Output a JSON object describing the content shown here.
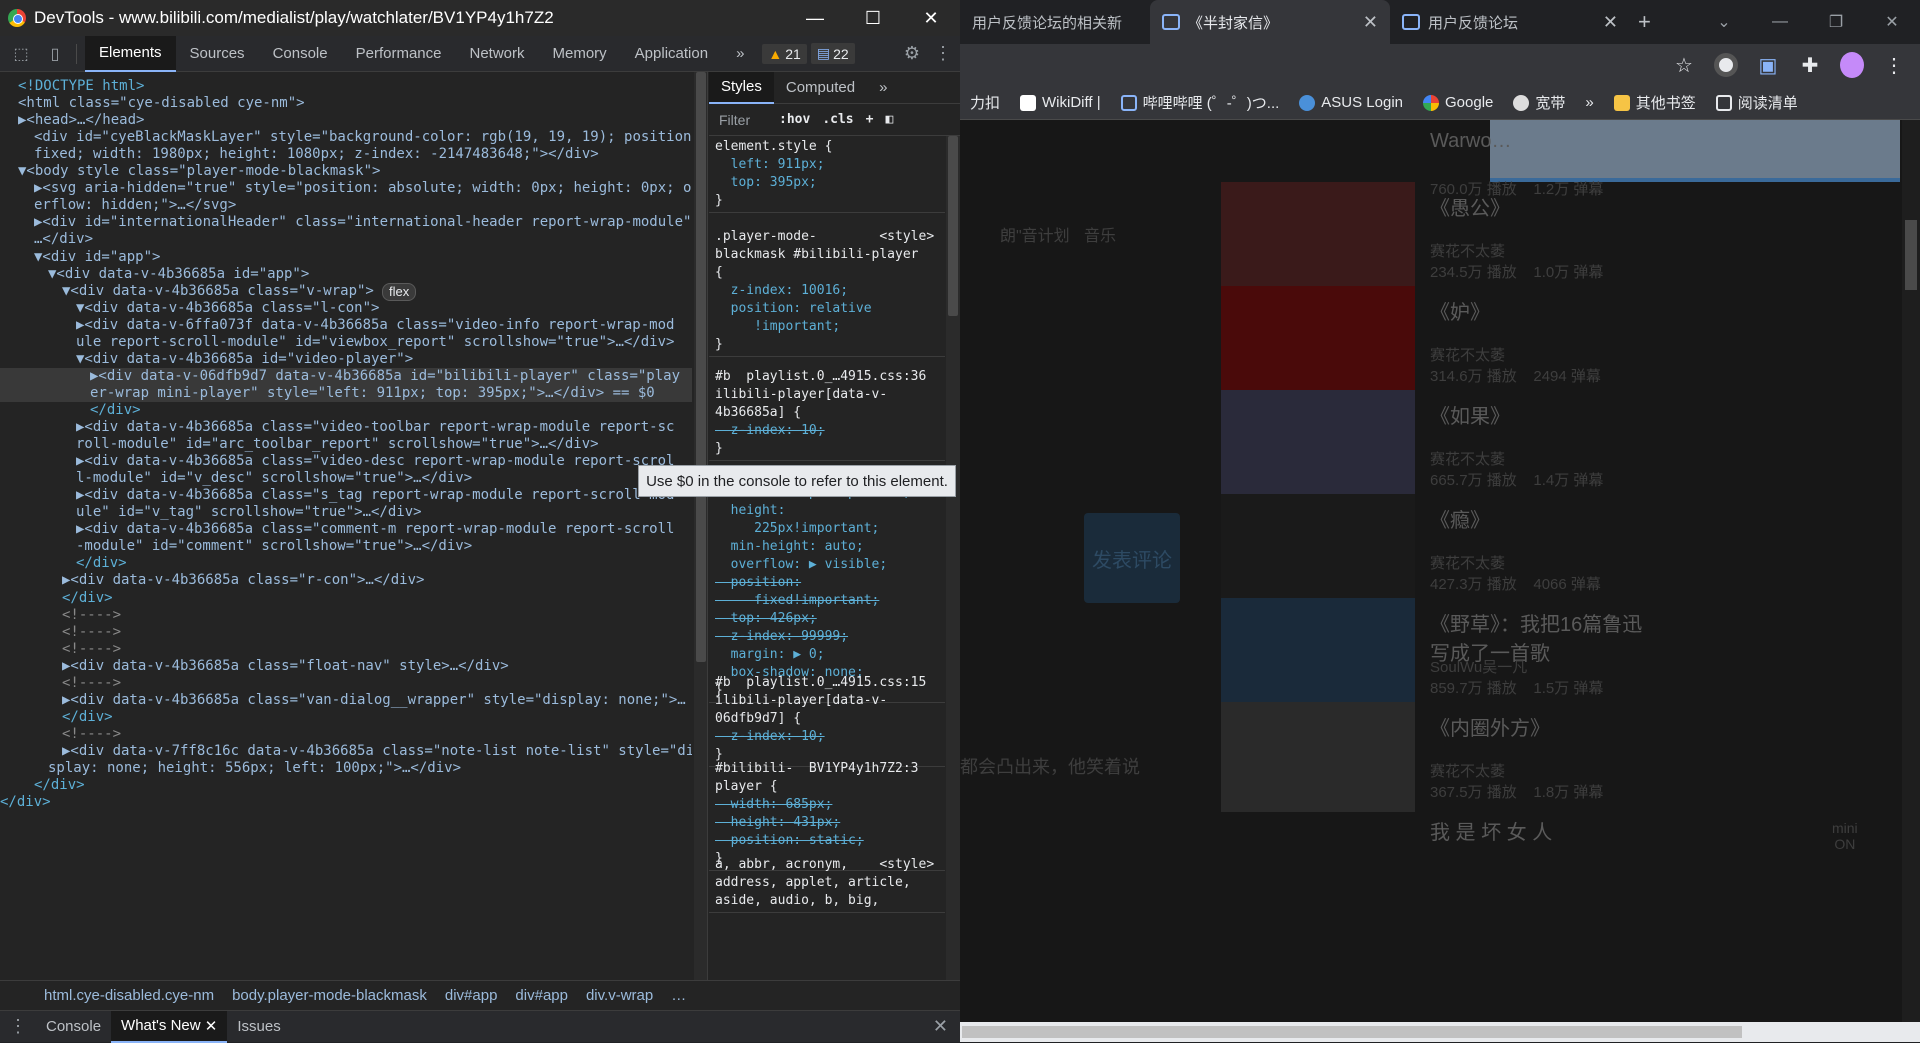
{
  "devtools": {
    "title": "DevTools - www.bilibili.com/medialist/play/watchlater/BV1YP4y1h7Z2",
    "window_buttons": [
      "—",
      "☐",
      "✕"
    ],
    "tabs": [
      "Elements",
      "Sources",
      "Console",
      "Performance",
      "Network",
      "Memory",
      "Application"
    ],
    "more_tabs": "»",
    "warnings": "21",
    "messages": "22",
    "dom_lines": [
      {
        "k": "doctype",
        "t": "<!DOCTYPE html>"
      },
      {
        "k": "t1",
        "t": "<html class=\"cye-disabled cye-nm\">"
      },
      {
        "k": "t2",
        "t": "▶<head>…</head>"
      },
      {
        "k": "t3",
        "t": "<div id=\"cyeBlackMaskLayer\" style=\"background-color: rgb(19, 19, 19); position:"
      },
      {
        "k": "t4",
        "t": "fixed; width: 1980px; height: 1080px; z-index: -2147483648;\"></div>"
      },
      {
        "k": "t5",
        "t": "▼<body style class=\"player-mode-blackmask\">"
      },
      {
        "k": "t6",
        "t": "▶<svg aria-hidden=\"true\" style=\"position: absolute; width: 0px; height: 0px; ov"
      },
      {
        "k": "t7",
        "t": "erflow: hidden;\">…</svg>"
      },
      {
        "k": "t8",
        "t": "▶<div id=\"internationalHeader\" class=\"international-header report-wrap-module\">"
      },
      {
        "k": "t9",
        "t": "…</div>"
      },
      {
        "k": "t10",
        "t": "▼<div id=\"app\">"
      },
      {
        "k": "t11",
        "t": "▼<div data-v-4b36685a id=\"app\">"
      },
      {
        "k": "t12",
        "t": "▼<div data-v-4b36685a class=\"v-wrap\">"
      },
      {
        "k": "t13",
        "t": "▼<div data-v-4b36685a class=\"l-con\">"
      },
      {
        "k": "t14",
        "t": "▶<div data-v-6ffa073f data-v-4b36685a class=\"video-info report-wrap-mod"
      },
      {
        "k": "t15",
        "t": "ule report-scroll-module\" id=\"viewbox_report\" scrollshow=\"true\">…</div>"
      },
      {
        "k": "t16",
        "t": "▼<div data-v-4b36685a id=\"video-player\">"
      },
      {
        "k": "t17",
        "t": "▶<div data-v-06dfb9d7 data-v-4b36685a id=\"bilibili-player\" class=\"play"
      },
      {
        "k": "t18",
        "t": "er-wrap mini-player\" style=\"left: 911px; top: 395px;\">…</div> == $0"
      },
      {
        "k": "t19",
        "t": "</div>"
      },
      {
        "k": "t20",
        "t": "▶<div data-v-4b36685a class=\"video-toolbar report-wrap-module report-sc"
      },
      {
        "k": "t21",
        "t": "roll-module\" id=\"arc_toolbar_report\" scrollshow=\"true\">…</div>"
      },
      {
        "k": "t22",
        "t": "▶<div data-v-4b36685a class=\"video-desc report-wrap-module report-scrol"
      },
      {
        "k": "t23",
        "t": "l-module\" id=\"v_desc\" scrollshow=\"true\">…</div>"
      },
      {
        "k": "t24",
        "t": "▶<div data-v-4b36685a class=\"s_tag report-wrap-module report-scroll-mod"
      },
      {
        "k": "t25",
        "t": "ule\" id=\"v_tag\" scrollshow=\"true\">…</div>"
      },
      {
        "k": "t26",
        "t": "▶<div data-v-4b36685a class=\"comment-m report-wrap-module report-scroll"
      },
      {
        "k": "t27",
        "t": "-module\" id=\"comment\" scrollshow=\"true\">…</div>"
      },
      {
        "k": "t28",
        "t": "</div>"
      },
      {
        "k": "t29",
        "t": "▶<div data-v-4b36685a class=\"r-con\">…</div>"
      },
      {
        "k": "t30",
        "t": "</div>"
      },
      {
        "k": "t31",
        "t": "<!---->"
      },
      {
        "k": "t32",
        "t": "<!---->"
      },
      {
        "k": "t33",
        "t": "<!---->"
      },
      {
        "k": "t34",
        "t": "▶<div data-v-4b36685a class=\"float-nav\" style>…</div>"
      },
      {
        "k": "t35",
        "t": "<!---->"
      },
      {
        "k": "t36",
        "t": "▶<div data-v-4b36685a class=\"van-dialog__wrapper\" style=\"display: none;\">…"
      },
      {
        "k": "t37",
        "t": "</div>"
      },
      {
        "k": "t38",
        "t": "<!---->"
      },
      {
        "k": "t39",
        "t": "▶<div data-v-7ff8c16c data-v-4b36685a class=\"note-list note-list\" style=\"di"
      },
      {
        "k": "t40",
        "t": "splay: none; height: 556px; left: 100px;\">…</div>"
      },
      {
        "k": "t41",
        "t": "</div>"
      },
      {
        "k": "t42",
        "t": "</div>"
      }
    ],
    "flex_badge": "flex",
    "tooltip": "Use $0 in the console to refer to this element.",
    "styles": {
      "tabs": [
        "Styles",
        "Computed",
        "»"
      ],
      "filter_placeholder": "Filter",
      "hov": ":hov",
      "cls": ".cls",
      "rules": [
        {
          "lines": [
            "element.style {",
            "  left: 911px;",
            "  top: 395px;",
            "}"
          ]
        },
        {
          "lines": [
            ".player-mode-        <style>",
            "blackmask #bilibili-player",
            "{",
            "  z-index: 10016;",
            "  position: relative",
            "     !important;",
            "}"
          ]
        },
        {
          "lines": [
            "#b  playlist.0_…4915.css:36",
            "ilibili-player[data-v-",
            "4b36685a] {",
            "  z-index: 10;",
            "}"
          ]
        },
        {
          "lines": [
            "{",
            "  width: 400px!important;",
            "  height:",
            "     225px!important;",
            "  min-height: auto;",
            "  overflow: ▶ visible;",
            "  position:",
            "     fixed!important;",
            "  top: 426px;",
            "  z-index: 99999;",
            "  margin: ▶ 0;",
            "  box-shadow: none;",
            "}"
          ]
        },
        {
          "lines": [
            "#b  playlist.0_…4915.css:15",
            "ilibili-player[data-v-",
            "06dfb9d7] {",
            "  z-index: 10;",
            "}"
          ]
        },
        {
          "lines": [
            "#bilibili-  BV1YP4y1h7Z2:3",
            "player {",
            "  width: 685px;",
            "  height: 431px;",
            "  position: static;",
            "}"
          ]
        },
        {
          "lines": [
            "a, abbr, acronym,    <style>",
            "address, applet, article,",
            "aside, audio, b, big,"
          ]
        }
      ]
    },
    "breadcrumbs": [
      "html.cye-disabled.cye-nm",
      "body.player-mode-blackmask",
      "div#app",
      "div#app",
      "div.v-wrap",
      "…"
    ],
    "drawer_tabs": [
      "Console",
      "What's New",
      "Issues"
    ]
  },
  "browser": {
    "tabs": [
      "用户反馈论坛的相关新",
      "《半封家信》",
      "用户反馈论坛"
    ],
    "new_tab": "+",
    "bookmarks": [
      "力扣",
      "WikiDiff |",
      "哔哩哔哩 (゜-゜)つ...",
      "ASUS Login",
      "Google",
      "宽带",
      "»",
      "其他书签",
      "阅读清单"
    ],
    "left_texts": [
      "朗\"音计划",
      "音乐",
      "都会凸出来，他笑着说"
    ],
    "post_button": "发表评论",
    "videos": [
      {
        "title": "Warwo…",
        "meta": "760.0万 播放    1.2万 弹幕"
      },
      {
        "title": "《愚公》",
        "meta": "赛花不太萎\n234.5万 播放    1.0万 弹幕"
      },
      {
        "title": "《妒》",
        "meta": "赛花不太萎\n314.6万 播放    2494 弹幕"
      },
      {
        "title": "《如果》",
        "meta": "赛花不太萎\n665.7万 播放    1.4万 弹幕"
      },
      {
        "title": "《瘾》",
        "meta": "赛花不太萎\n427.3万 播放    4066 弹幕"
      },
      {
        "title": "《野草》：我把16篇鲁迅\n写成了一首歌",
        "meta": "SoulWu吴一凡\n859.7万 播放    1.5万 弹幕"
      },
      {
        "title": "《内圈外方》",
        "meta": "赛花不太萎\n367.5万 播放    1.8万 弹幕"
      },
      {
        "title": "我 是 坏 女 人",
        "meta": ""
      }
    ],
    "side_float": "mini\nON"
  }
}
